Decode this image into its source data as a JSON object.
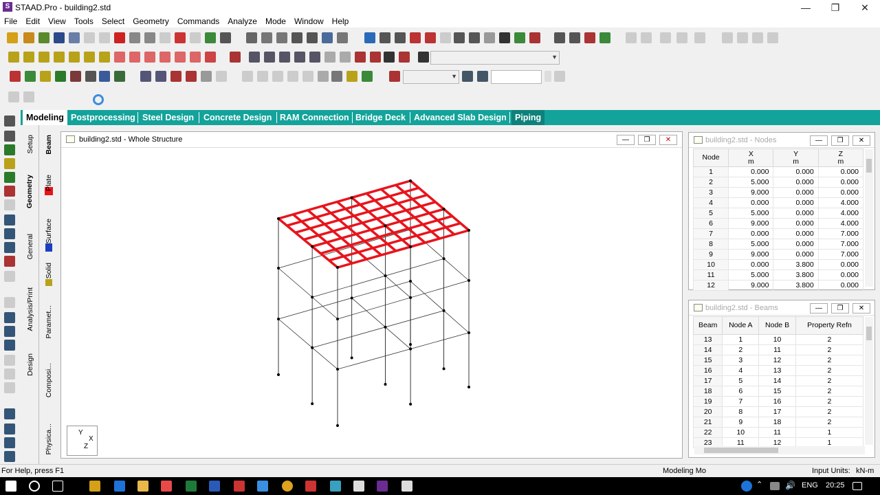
{
  "window": {
    "title": "STAAD.Pro - building2.std"
  },
  "menu": [
    "File",
    "Edit",
    "View",
    "Tools",
    "Select",
    "Geometry",
    "Commands",
    "Analyze",
    "Mode",
    "Window",
    "Help"
  ],
  "tabs": [
    "Modeling",
    "Postprocessing",
    "Steel Design",
    "Concrete Design",
    "RAM Connection",
    "Bridge Deck",
    "Advanced Slab Design",
    "Piping"
  ],
  "vertical_tabs_outer": [
    "Setup",
    "Geometry",
    "General",
    "Analysis/Print",
    "Design"
  ],
  "vertical_tabs_inner": [
    "Beam",
    "Plate",
    "Surface",
    "Solid",
    "Paramet...",
    "Composi...",
    "Physica..."
  ],
  "structure_window": {
    "title": "building2.std - Whole Structure"
  },
  "axis_triad": {
    "y": "Y",
    "x": "X",
    "z": "Z"
  },
  "nodes_window": {
    "title": "building2.std - Nodes",
    "headers": [
      "Node",
      "X\nm",
      "Y\nm",
      "Z\nm"
    ],
    "rows": [
      [
        "1",
        "0.000",
        "0.000",
        "0.000"
      ],
      [
        "2",
        "5.000",
        "0.000",
        "0.000"
      ],
      [
        "3",
        "9.000",
        "0.000",
        "0.000"
      ],
      [
        "4",
        "0.000",
        "0.000",
        "4.000"
      ],
      [
        "5",
        "5.000",
        "0.000",
        "4.000"
      ],
      [
        "6",
        "9.000",
        "0.000",
        "4.000"
      ],
      [
        "7",
        "0.000",
        "0.000",
        "7.000"
      ],
      [
        "8",
        "5.000",
        "0.000",
        "7.000"
      ],
      [
        "9",
        "9.000",
        "0.000",
        "7.000"
      ],
      [
        "10",
        "0.000",
        "3.800",
        "0.000"
      ],
      [
        "11",
        "5.000",
        "3.800",
        "0.000"
      ],
      [
        "12",
        "9.000",
        "3.800",
        "0.000"
      ]
    ]
  },
  "beams_window": {
    "title": "building2.std - Beams",
    "headers": [
      "Beam",
      "Node A",
      "Node B",
      "Property Refn"
    ],
    "rows": [
      [
        "13",
        "1",
        "10",
        "2"
      ],
      [
        "14",
        "2",
        "11",
        "2"
      ],
      [
        "15",
        "3",
        "12",
        "2"
      ],
      [
        "16",
        "4",
        "13",
        "2"
      ],
      [
        "17",
        "5",
        "14",
        "2"
      ],
      [
        "18",
        "6",
        "15",
        "2"
      ],
      [
        "19",
        "7",
        "16",
        "2"
      ],
      [
        "20",
        "8",
        "17",
        "2"
      ],
      [
        "21",
        "9",
        "18",
        "2"
      ],
      [
        "22",
        "10",
        "11",
        "1"
      ],
      [
        "23",
        "11",
        "12",
        "1"
      ]
    ]
  },
  "status": {
    "help": "For Help, press F1",
    "mode": "Modeling Mo",
    "units_label": "Input Units:",
    "units_value": "kN-m"
  },
  "taskbar": {
    "lang": "ENG",
    "time": "20:25"
  },
  "colors": {
    "tab_bar": "#13a39a",
    "selected_members": "#e8141c",
    "title_icon": "#6a2c91"
  }
}
